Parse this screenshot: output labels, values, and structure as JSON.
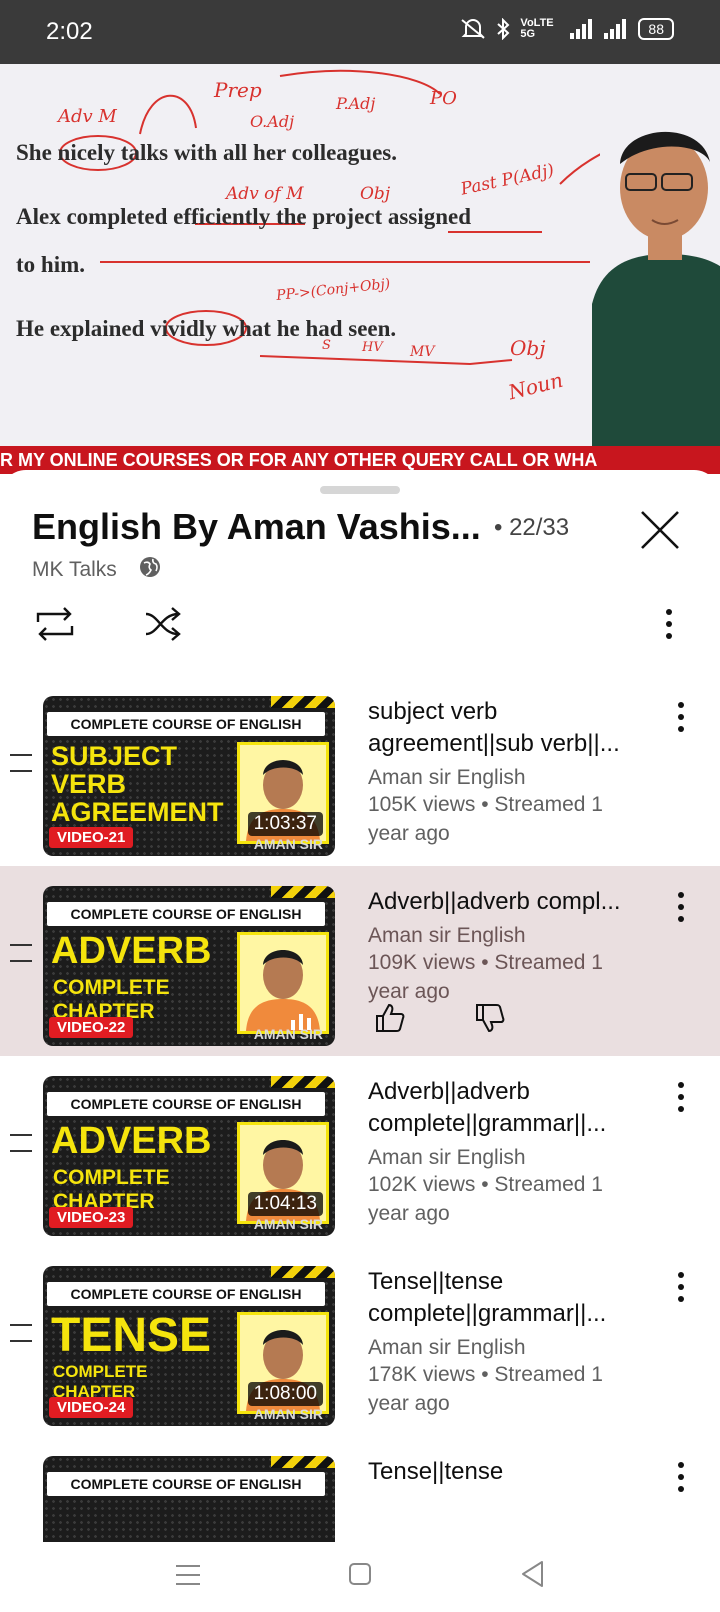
{
  "status_bar": {
    "time": "2:02",
    "network": "VoLTE 5G",
    "battery": "88"
  },
  "video": {
    "board_lines": [
      "She nicely talks with all her colleagues.",
      "Alex completed efficiently the project assigned",
      "to him.",
      "He explained vividly what he had seen."
    ],
    "annotations": [
      "Adv M",
      "Prep",
      "O.Adj",
      "P.Adj",
      "PO",
      "Adv of M",
      "Obj",
      "Past P(Adj)",
      "PP->(Conj+Obj)",
      "S",
      "HV",
      "MV",
      "Obj",
      "Noun"
    ],
    "ticker": "R MY ONLINE COURSES OR FOR ANY OTHER QUERY CALL OR WHA"
  },
  "playlist": {
    "title": "English By Aman Vashis...",
    "position": "• 22/33",
    "channel": "MK Talks",
    "items": [
      {
        "banner": "COMPLETE COURSE OF ENGLISH",
        "big": "SUBJECT VERB AGREEMENT",
        "sub": "",
        "video_tag": "VIDEO-21",
        "duration": "1:03:37",
        "brand": "AMAN SIR",
        "title": "subject verb agreement||sub verb||...",
        "channel": "Aman sir English",
        "stats": "105K views • Streamed 1 year ago",
        "active": false
      },
      {
        "banner": "COMPLETE COURSE OF ENGLISH",
        "big": "ADVERB",
        "sub": "COMPLETE CHAPTER",
        "video_tag": "VIDEO-22",
        "duration": "",
        "brand": "AMAN SIR",
        "title": "Adverb||adverb compl...",
        "channel": "Aman sir English",
        "stats": "109K views • Streamed 1 year ago",
        "active": true
      },
      {
        "banner": "COMPLETE COURSE OF ENGLISH",
        "big": "ADVERB",
        "sub": "COMPLETE CHAPTER",
        "video_tag": "VIDEO-23",
        "duration": "1:04:13",
        "brand": "AMAN SIR",
        "title": "Adverb||adverb complete||grammar||...",
        "channel": "Aman sir English",
        "stats": "102K views • Streamed 1 year ago",
        "active": false
      },
      {
        "banner": "COMPLETE COURSE OF ENGLISH",
        "big": "TENSE",
        "sub": "COMPLETE CHAPTER",
        "video_tag": "VIDEO-24",
        "duration": "1:08:00",
        "brand": "AMAN SIR",
        "title": "Tense||tense complete||grammar||...",
        "channel": "Aman sir English",
        "stats": "178K views • Streamed 1 year ago",
        "active": false
      },
      {
        "banner": "COMPLETE COURSE OF ENGLISH",
        "title": "Tense||tense"
      }
    ]
  },
  "colors": {
    "ticker": "#c8161e",
    "highlight": "#eadfe0",
    "thumb_yellow": "#f5e40d",
    "video_tag": "#e01c22"
  }
}
